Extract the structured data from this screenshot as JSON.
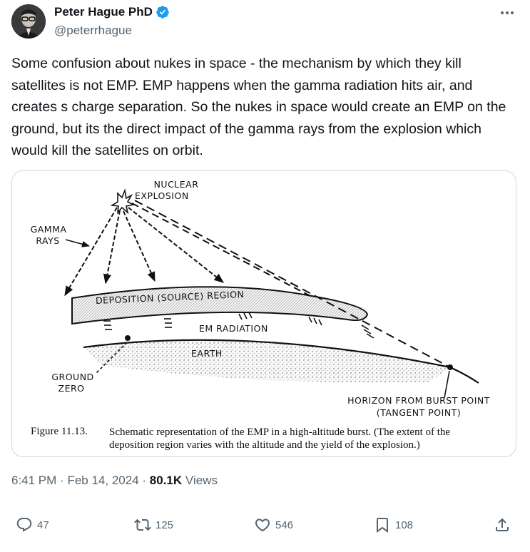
{
  "author": {
    "name": "Peter Hague PhD",
    "handle": "@peterrhague",
    "verified": true,
    "verified_color": "#1d9bf0"
  },
  "tweet": {
    "text": "Some confusion about nukes in space - the mechanism by which they kill satellites is not EMP. EMP happens when the gamma radiation hits air, and creates s charge separation. So the nukes in space would create an EMP on the ground, but its the direct impact of the gamma rays from the explosion which would kill the satellites on orbit."
  },
  "figure": {
    "labels": {
      "nuclear": "NUCLEAR",
      "explosion": "EXPLOSION",
      "gamma": "GAMMA",
      "rays": "RAYS",
      "deposition_region": "DEPOSITION (SOURCE) REGION",
      "em_radiation": "EM RADIATION",
      "earth": "EARTH",
      "ground": "GROUND",
      "zero": "ZERO",
      "horizon": "HORIZON FROM BURST POINT",
      "tangent": "(TANGENT POINT)"
    },
    "caption_number": "Figure 11.13.",
    "caption_text": "Schematic representation of the EMP in a high-altitude burst. (The extent of the deposition region varies with the altitude and the yield of the explosion.)"
  },
  "meta": {
    "time": "6:41 PM",
    "separator": "·",
    "date": "Feb 14, 2024",
    "views_count": "80.1K",
    "views_label": "Views"
  },
  "actions": {
    "replies": "47",
    "reposts": "125",
    "likes": "546",
    "bookmarks": "108"
  },
  "icons": [
    "verified-badge-icon",
    "more-icon",
    "reply-icon",
    "repost-icon",
    "like-icon",
    "bookmark-icon",
    "share-icon"
  ]
}
